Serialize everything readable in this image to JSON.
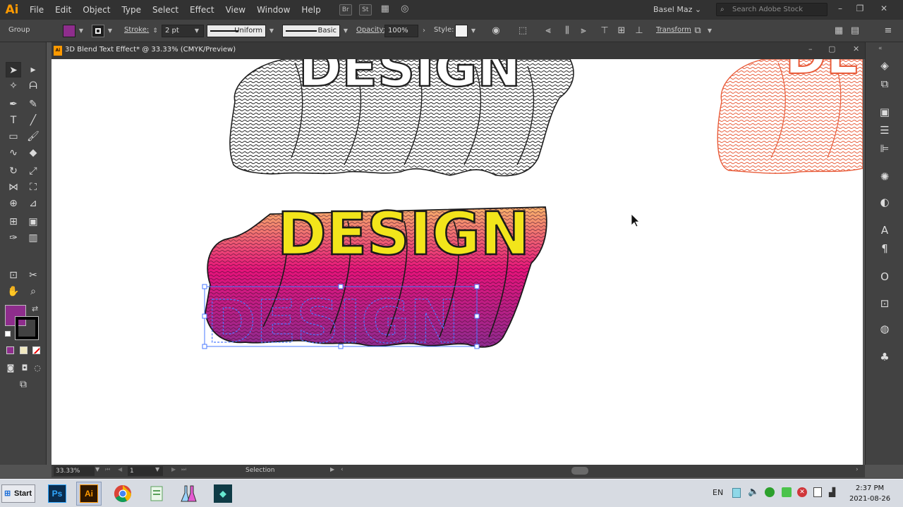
{
  "app": {
    "logo": "Ai",
    "brand_color": "#ff9a00"
  },
  "menubar": {
    "items": [
      "File",
      "Edit",
      "Object",
      "Type",
      "Select",
      "Effect",
      "View",
      "Window",
      "Help"
    ],
    "icons": [
      "bridge-icon",
      "stock-icon",
      "arrange-documents-icon",
      "gpu-performance-icon"
    ],
    "br_label": "Br",
    "st_label": "St",
    "user": "Basel Maz",
    "search_placeholder": "Search Adobe Stock"
  },
  "controlbar": {
    "group_label": "Group",
    "fill_color": "#8e2d8c",
    "stroke_label": "Stroke:",
    "stroke_value": "2 pt",
    "profile_label": "Uniform",
    "brush_label": "Basic",
    "opacity_label": "Opacity:",
    "opacity_value": "100%",
    "style_label": "Style:",
    "transform_label": "Transform"
  },
  "document": {
    "tab_title": "3D Blend Text Effect* @ 33.33% (CMYK/Preview)",
    "artwork_text": "DESIGN",
    "colors": {
      "top_fill": "#f2e51b",
      "blend_magenta": "#e5137a",
      "blend_purple": "#8e2a8f",
      "blend_orange": "#f5a15a",
      "outline_orange": "#e85c3a",
      "selection": "#4a78ff"
    }
  },
  "tools": {
    "fill_color": "#8e2d8c",
    "stroke_color": "#000000"
  },
  "statusbar": {
    "zoom": "33.33%",
    "artboard": "1",
    "tool_name": "Selection"
  },
  "taskbar": {
    "start_label": "Start",
    "apps": [
      {
        "name": "photoshop",
        "label": "Ps",
        "color": "#0b2d4e",
        "text": "#31a8ff"
      },
      {
        "name": "illustrator",
        "label": "Ai",
        "color": "#2e1700",
        "text": "#ff9a00"
      },
      {
        "name": "chrome",
        "label": "",
        "color": "#ffffff",
        "text": "#000"
      },
      {
        "name": "files",
        "label": "",
        "color": "#ffffff",
        "text": "#000"
      },
      {
        "name": "lab",
        "label": "",
        "color": "#ffffff",
        "text": "#000"
      },
      {
        "name": "filmora",
        "label": "",
        "color": "#0f3b46",
        "text": "#67e8d0"
      }
    ],
    "language": "EN",
    "time": "2:37 PM",
    "date": "2021-08-26"
  }
}
